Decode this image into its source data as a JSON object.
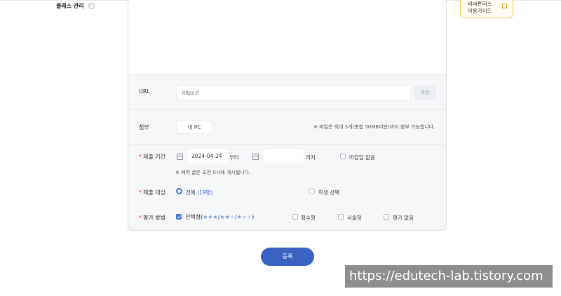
{
  "header": {
    "side_title": "클래스 관리",
    "guide_line1": "비바튼러스",
    "guide_line2": "이용가이드"
  },
  "url_row": {
    "label": "URL",
    "placeholder": "https://",
    "save_label": "저장"
  },
  "attach_row": {
    "label": "첨부",
    "pc_button": "내 PC",
    "note": "※ 파일은 최대 5개(총합 50MB미만)까지 첨부 가능합니다."
  },
  "period_row": {
    "label": "제출 기간",
    "start_date": "2024-04-24",
    "from_text": "부터",
    "end_date": "",
    "until_text": "까지",
    "no_deadline_label": "마감일 없음",
    "note": "※ 예약 글은 오전 0시에 게시됩니다."
  },
  "target_row": {
    "label": "제출 대상",
    "all_label": "전체",
    "all_count": "(19명)",
    "select_label": "학생 선택"
  },
  "eval_row": {
    "label": "평가 방법",
    "option1_prefix": "선택형(",
    "option1_suffix": ")",
    "option2": "점수형",
    "option3": "서술형",
    "option4": "평가 없음"
  },
  "actions": {
    "submit_label": "등록"
  },
  "watermark": "https://edutech-lab.tistory.com",
  "colors": {
    "accent": "#3a63c2",
    "required": "#d83b3b",
    "guide_border": "#f2c84b"
  }
}
